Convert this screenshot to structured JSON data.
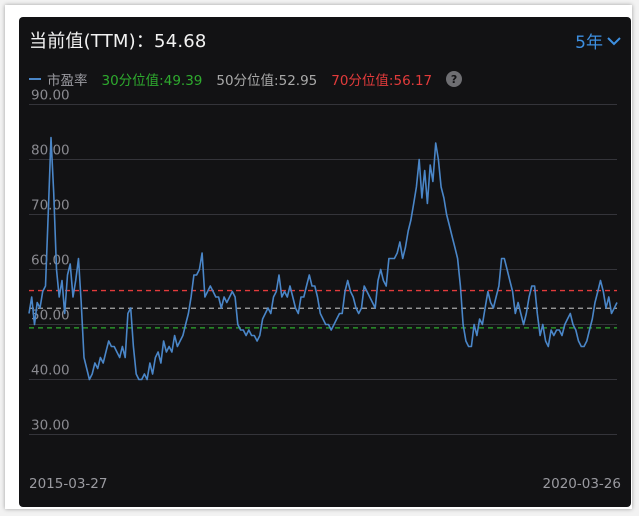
{
  "header": {
    "title": "当前值(TTM)：54.68",
    "period_label": "5年"
  },
  "legend": {
    "series_label": "市盈率",
    "p30_label": "30分位值:49.39",
    "p50_label": "50分位值:52.95",
    "p70_label": "70分位值:56.17",
    "help_label": "?"
  },
  "colors": {
    "background": "#121214",
    "line": "#4a86c8",
    "p30": "#2eaa2e",
    "p50": "#a9a9a9",
    "p70": "#e23b3b",
    "period": "#3d8fe0",
    "grid": "#34343a"
  },
  "chart_data": {
    "type": "line",
    "title": "",
    "xlabel": "",
    "ylabel": "",
    "x_start_label": "2015-03-27",
    "x_end_label": "2020-03-26",
    "ylim": [
      25,
      95
    ],
    "yticks": [
      "90.00",
      "80.00",
      "70.00",
      "60.00",
      "50.00",
      "40.00",
      "30.00"
    ],
    "grid": "horizontal",
    "reference_lines": [
      {
        "name": "30分位值",
        "value": 49.39
      },
      {
        "name": "50分位值",
        "value": 52.95
      },
      {
        "name": "70分位值",
        "value": 56.17
      }
    ],
    "series": [
      {
        "name": "市盈率",
        "values": [
          52,
          55,
          50,
          54,
          53,
          56,
          57,
          70,
          84,
          74,
          60,
          55,
          58,
          52,
          59,
          61,
          55,
          58,
          62,
          54,
          44,
          42,
          40,
          41,
          43,
          42,
          44,
          43,
          45,
          47,
          46,
          46,
          45,
          44,
          46,
          44,
          52,
          53,
          46,
          41,
          40,
          40,
          41,
          40,
          43,
          41,
          44,
          45,
          43,
          47,
          45,
          46,
          45,
          48,
          46,
          47,
          48,
          50,
          52,
          55,
          59,
          59,
          60,
          63,
          55,
          56,
          57,
          56,
          55,
          55,
          53,
          55,
          54,
          55,
          56,
          55,
          50,
          49,
          49,
          48,
          49,
          48,
          48,
          47,
          48,
          51,
          52,
          53,
          52,
          55,
          56,
          59,
          55,
          56,
          55,
          57,
          55,
          53,
          52,
          55,
          55,
          57,
          59,
          57,
          57,
          55,
          52,
          51,
          50,
          50,
          49,
          50,
          51,
          52,
          52,
          56,
          58,
          56,
          55,
          53,
          52,
          53,
          57,
          56,
          55,
          54,
          53,
          58,
          60,
          58,
          57,
          62,
          62,
          62,
          63,
          65,
          62,
          64,
          67,
          69,
          72,
          75,
          80,
          73,
          78,
          72,
          79,
          76,
          83,
          80,
          75,
          73,
          70,
          68,
          66,
          64,
          62,
          57,
          50,
          47,
          46,
          46,
          50,
          48,
          51,
          50,
          53,
          56,
          54,
          53,
          55,
          57,
          62,
          62,
          60,
          58,
          56,
          52,
          54,
          52,
          50,
          52,
          55,
          57,
          57,
          52,
          48,
          50,
          47,
          46,
          49,
          48,
          49,
          49,
          48,
          50,
          51,
          52,
          50,
          49,
          47,
          46,
          46,
          47,
          49,
          51,
          54,
          56,
          58,
          56,
          53,
          55,
          52,
          53,
          54
        ]
      }
    ]
  }
}
